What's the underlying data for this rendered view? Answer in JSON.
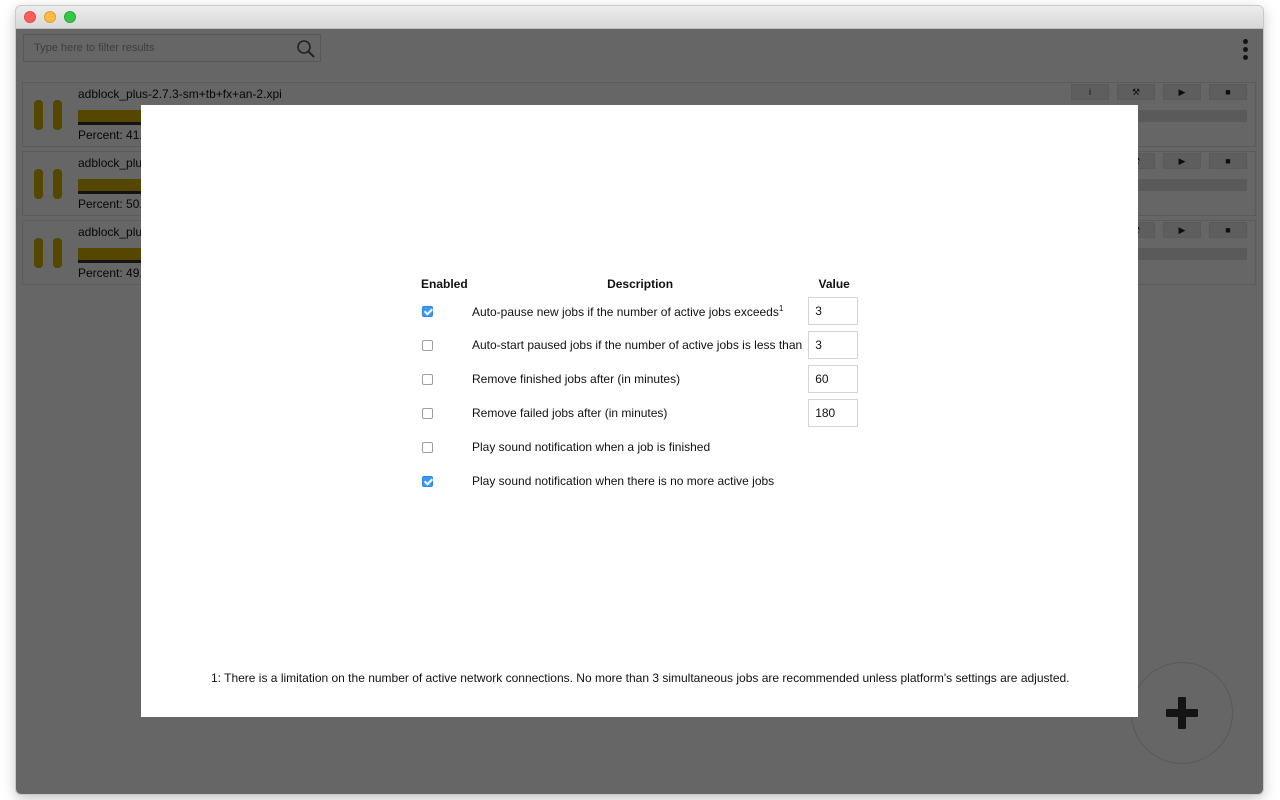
{
  "search": {
    "placeholder": "Type here to filter results"
  },
  "jobs": [
    {
      "name": "adblock_plus-2.7.3-sm+tb+fx+an-2.xpi",
      "percent_label": "Percent: 41.",
      "progress": 0.41
    },
    {
      "name": "adblock_plu",
      "percent_label": "Percent: 50.",
      "progress": 0.5
    },
    {
      "name": "adblock_plu",
      "percent_label": "Percent: 49.",
      "progress": 0.49
    }
  ],
  "job_actions": [
    {
      "name": "info-icon",
      "glyph": "i"
    },
    {
      "name": "tools-icon",
      "glyph": "⚒"
    },
    {
      "name": "play-icon",
      "glyph": "▶"
    },
    {
      "name": "stop-icon",
      "glyph": "■"
    }
  ],
  "dialog": {
    "headers": {
      "enabled": "Enabled",
      "description": "Description",
      "value": "Value"
    },
    "rows": [
      {
        "enabled": true,
        "description": "Auto-pause new jobs if the number of active jobs exceeds",
        "sup": "1",
        "value": "3"
      },
      {
        "enabled": false,
        "description": "Auto-start paused jobs if the number of active jobs is less than",
        "value": "3"
      },
      {
        "enabled": false,
        "description": "Remove finished jobs after (in minutes)",
        "value": "60"
      },
      {
        "enabled": false,
        "description": "Remove failed jobs after (in minutes)",
        "value": "180"
      },
      {
        "enabled": false,
        "description": "Play sound notification when a job is finished"
      },
      {
        "enabled": true,
        "description": "Play sound notification when there is no more active jobs"
      }
    ],
    "footnote": "1: There is a limitation on the number of active network connections. No more than 3 simultaneous jobs are recommended unless platform's settings are adjusted."
  },
  "colors": {
    "progress_fill": "#d4b000",
    "checkbox_checked": "#3b99fc",
    "overlay": "rgba(0,0,0,0.6)"
  }
}
